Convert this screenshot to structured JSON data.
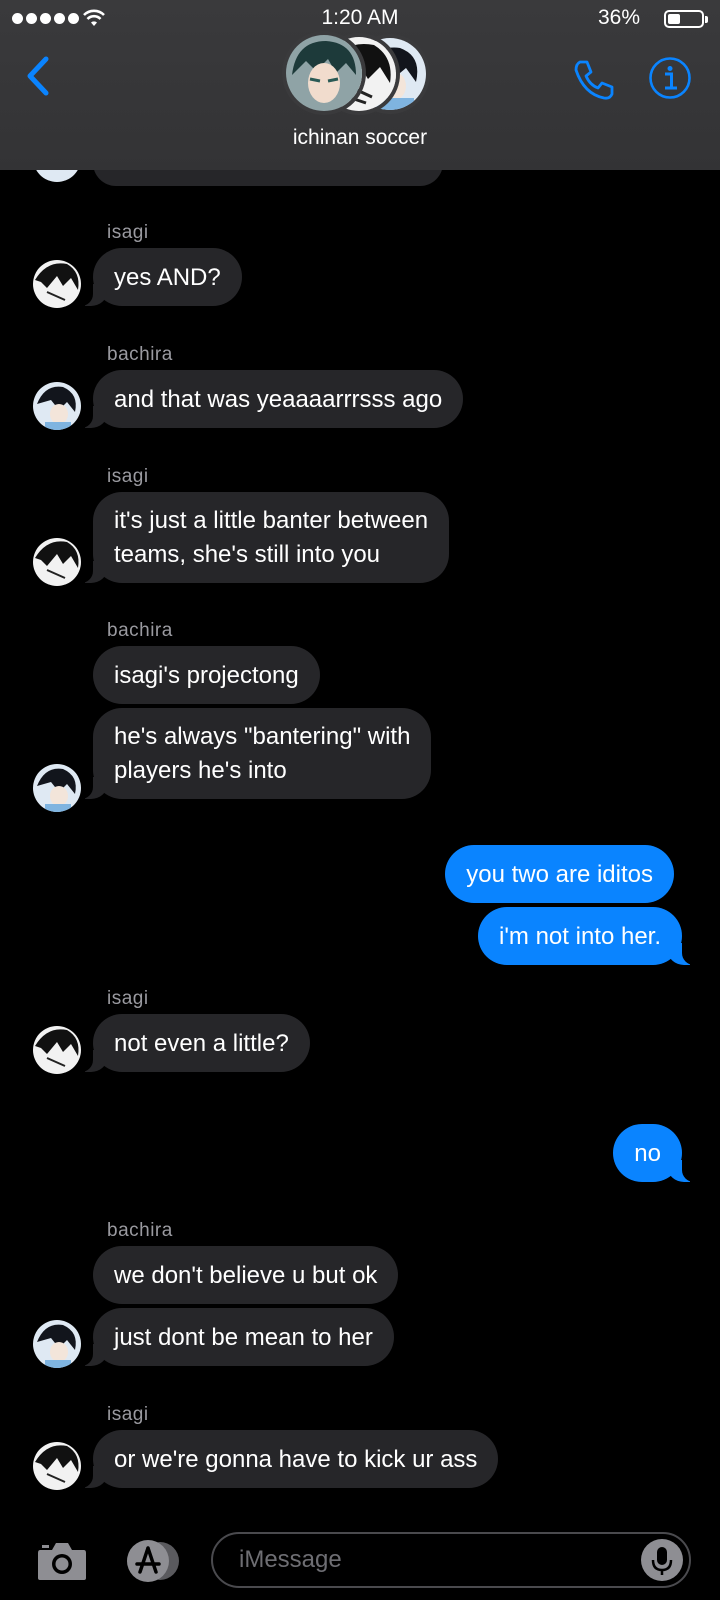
{
  "status": {
    "time": "1:20 AM",
    "battery": "36%",
    "battery_level": 0.36
  },
  "header": {
    "group_name": "ichinan soccer"
  },
  "messages": [
    {
      "sender": "isagi",
      "text": "yes AND?"
    },
    {
      "sender": "bachira",
      "text": "and that was yeaaaarrrsss ago"
    },
    {
      "sender": "isagi",
      "line1": "it's just a little banter between",
      "line2": "teams, she's still into you"
    },
    {
      "sender": "bachira",
      "text": "isagi's projectong"
    },
    {
      "line1": "he's always \"bantering\" with",
      "line2": "players he's into"
    },
    {
      "text": "you two are iditos"
    },
    {
      "text": "i'm not into her."
    },
    {
      "sender": "isagi",
      "text": "not even a little?"
    },
    {
      "text": "no"
    },
    {
      "sender": "bachira",
      "text": "we don't believe u but ok"
    },
    {
      "text": "just dont be mean to her"
    },
    {
      "sender": "isagi",
      "text": "or we're gonna have to kick ur ass"
    }
  ],
  "composer": {
    "placeholder": "iMessage"
  },
  "colors": {
    "accent": "#0a84ff",
    "incoming_bubble": "#262629",
    "header_bg": "#3a3a3c"
  },
  "icons": [
    "back-chevron-icon",
    "phone-icon",
    "info-icon",
    "camera-icon",
    "app-store-icon",
    "microphone-icon",
    "wifi-icon",
    "battery-icon"
  ]
}
